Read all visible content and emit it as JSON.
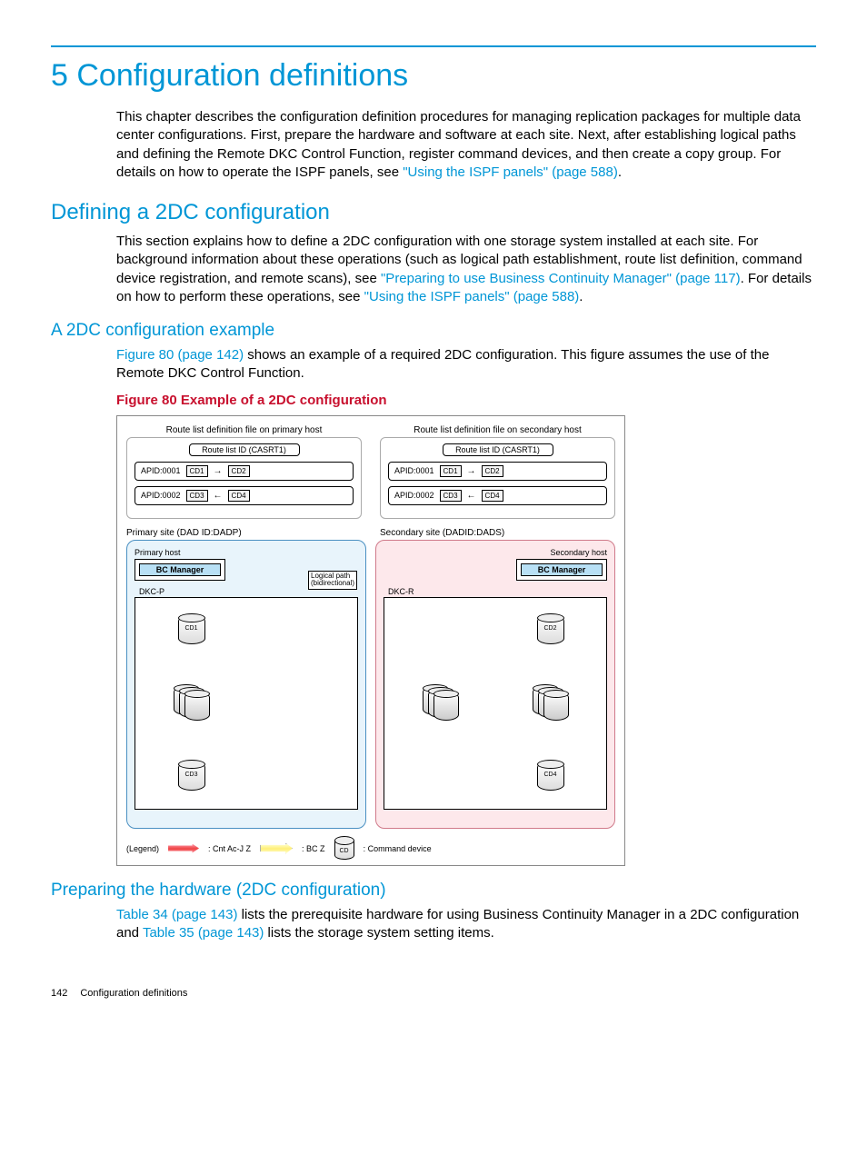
{
  "chapter": {
    "title": "5 Configuration definitions",
    "intro_part1": "This chapter describes the configuration definition procedures for managing replication packages for multiple data center configurations. First, prepare the hardware and software at each site. Next, after establishing logical paths and defining the Remote DKC Control Function, register command devices, and then create a copy group. For details on how to operate the ISPF panels, see ",
    "intro_link1": "\"Using the ISPF panels\" (page 588)",
    "intro_end1": "."
  },
  "section1": {
    "title": "Defining a 2DC configuration",
    "p1a": "This section explains how to define a 2DC configuration with one storage system installed at each site. For background information about these operations (such as logical path establishment, route list definition, command device registration, and remote scans), see ",
    "link1": "\"Preparing to use Business Continuity Manager\" (page 117)",
    "p1b": ". For details on how to perform these operations, see ",
    "link2": "\"Using the ISPF panels\" (page 588)",
    "p1c": "."
  },
  "subsection1": {
    "title": "A 2DC configuration example",
    "p_link": "Figure 80 (page 142)",
    "p_rest": " shows an example of a required 2DC configuration. This figure assumes the use of the Remote DKC Control Function."
  },
  "figure": {
    "caption": "Figure 80 Example of a 2DC configuration",
    "primary_file_label": "Route list definition file on primary host",
    "secondary_file_label": "Route list definition file on secondary host",
    "route_id": "Route list ID (CASRT1)",
    "apid1": "APID:0001",
    "apid2": "APID:0002",
    "cd1": "CD1",
    "cd2": "CD2",
    "cd3": "CD3",
    "cd4": "CD4",
    "primary_site": "Primary site  (DAD ID:DADP)",
    "secondary_site": "Secondary site  (DADID:DADS)",
    "primary_host": "Primary host",
    "secondary_host": "Secondary host",
    "bc_manager": "BC Manager",
    "dkc_p": "DKC-P",
    "dkc_r": "DKC-R",
    "logical_path": "Logical path\n(bidirectional)",
    "legend": "(Legend)",
    "legend_red": ": Cnt Ac-J Z",
    "legend_yellow": ": BC Z",
    "legend_cd": "CD",
    "legend_cd_text": ": Command device"
  },
  "subsection2": {
    "title": "Preparing the hardware (2DC configuration)",
    "p_link1": "Table 34 (page 143)",
    "p_mid": " lists the prerequisite hardware for using Business Continuity Manager in a 2DC configuration and ",
    "p_link2": "Table 35 (page 143)",
    "p_end": " lists the storage system setting items."
  },
  "footer": {
    "page_num": "142",
    "page_title": "Configuration definitions"
  }
}
